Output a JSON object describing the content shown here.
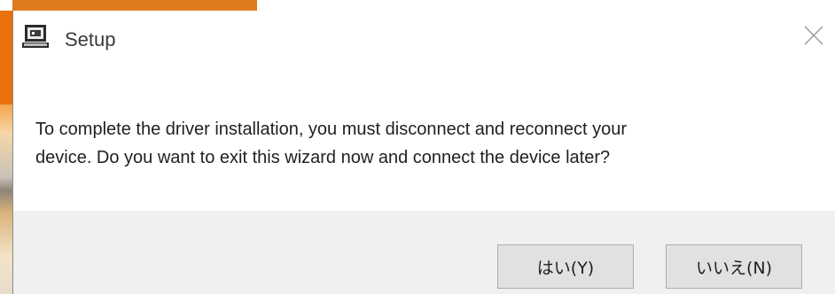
{
  "window": {
    "title": "Setup",
    "app_icon": "computer-setup-icon",
    "close_icon": "close-icon"
  },
  "message": {
    "line1": "To complete the driver installation, you must disconnect and reconnect your",
    "line2": "device. Do you want to exit this wizard now and connect the device later?"
  },
  "buttons": {
    "yes_label": "はい(Y)",
    "no_label": "いいえ(N)"
  },
  "colors": {
    "footer_background": "#f0f0f0",
    "button_background": "#e1e1e1",
    "button_border": "#adadad",
    "background_accent": "#e8720c"
  }
}
